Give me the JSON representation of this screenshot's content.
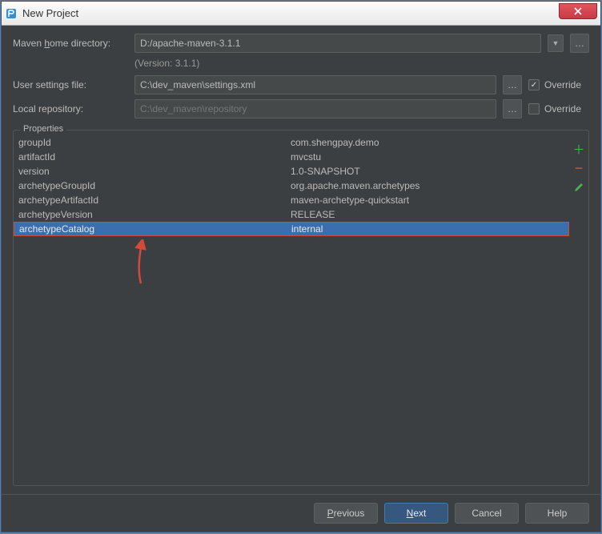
{
  "window": {
    "title": "New Project"
  },
  "form": {
    "mavenHomeLabelPre": "Maven ",
    "mavenHomeLabelMn": "h",
    "mavenHomeLabelPost": "ome directory:",
    "mavenHomeValue": "D:/apache-maven-3.1.1",
    "versionText": "(Version: 3.1.1)",
    "userSettingsLabel": "User settings file:",
    "userSettingsValue": "C:\\dev_maven\\settings.xml",
    "localRepoLabel": "Local repository:",
    "localRepoValue": "C:\\dev_maven\\repository",
    "overrideLabel": "Override",
    "override1": true,
    "override2": false
  },
  "properties": {
    "title": "Properties",
    "rows": [
      {
        "key": "groupId",
        "value": "com.shengpay.demo",
        "selected": false
      },
      {
        "key": "artifactId",
        "value": "mvcstu",
        "selected": false
      },
      {
        "key": "version",
        "value": "1.0-SNAPSHOT",
        "selected": false
      },
      {
        "key": "archetypeGroupId",
        "value": "org.apache.maven.archetypes",
        "selected": false
      },
      {
        "key": "archetypeArtifactId",
        "value": "maven-archetype-quickstart",
        "selected": false
      },
      {
        "key": "archetypeVersion",
        "value": "RELEASE",
        "selected": false
      },
      {
        "key": "archetypeCatalog",
        "value": "internal",
        "selected": true
      }
    ]
  },
  "buttons": {
    "previousMn": "P",
    "previousRest": "revious",
    "nextMn": "N",
    "nextRest": "ext",
    "cancel": "Cancel",
    "help": "Help"
  }
}
